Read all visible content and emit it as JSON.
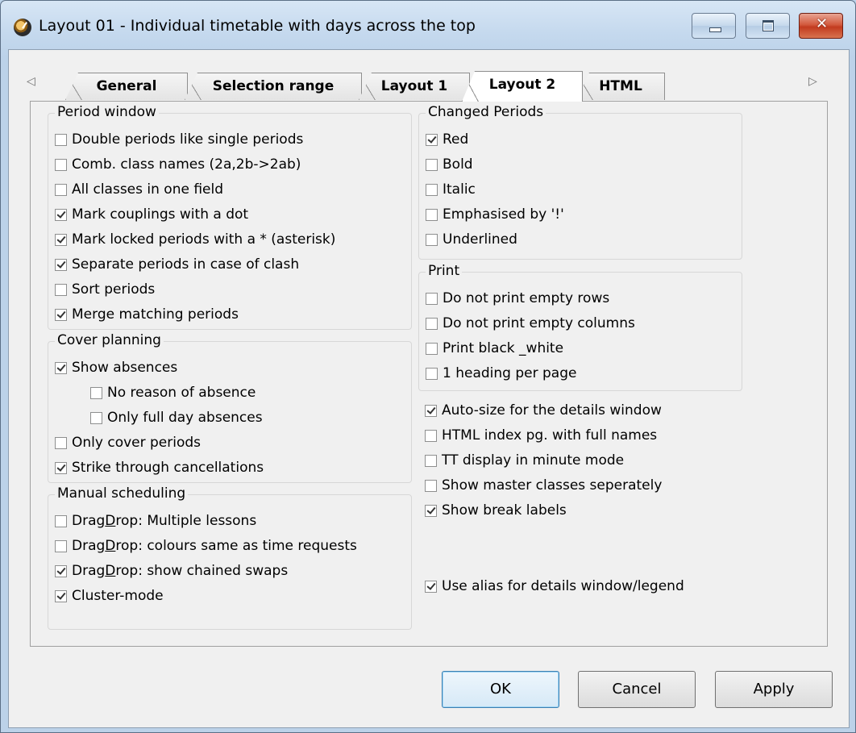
{
  "window": {
    "title": "Layout 01 - Individual timetable with days across the top",
    "controls": {
      "close_glyph": "✕"
    }
  },
  "tabs": [
    {
      "label": "General"
    },
    {
      "label": "Selection range"
    },
    {
      "label": "Layout 1"
    },
    {
      "label": "Layout 2"
    },
    {
      "label": "HTML"
    }
  ],
  "active_tab": "Layout 2",
  "tab_arrows": {
    "left": "◁",
    "right": "▷"
  },
  "groups": {
    "period_window": {
      "title": "Period window",
      "options": [
        {
          "label": "Double periods like single periods",
          "checked": false
        },
        {
          "label": "Comb. class names (2a,2b->2ab)",
          "checked": false
        },
        {
          "label": "All classes in one field",
          "checked": false
        },
        {
          "label": "Mark couplings with a dot",
          "checked": true
        },
        {
          "label": "Mark locked periods with a * (asterisk)",
          "checked": true
        },
        {
          "label": "Separate periods in case of clash",
          "checked": true
        },
        {
          "label": "Sort periods",
          "checked": false
        },
        {
          "label": "Merge matching periods",
          "checked": true
        }
      ]
    },
    "cover_planning": {
      "title": "Cover planning",
      "options": [
        {
          "label": "Show absences",
          "checked": true
        },
        {
          "label": "No reason of absence",
          "checked": false
        },
        {
          "label": "Only full day absences",
          "checked": false
        },
        {
          "label": "Only cover periods",
          "checked": false
        },
        {
          "label": "Strike through cancellations",
          "checked": true
        }
      ]
    },
    "manual_scheduling": {
      "title": "Manual scheduling",
      "options": [
        {
          "label_pre": "Drag",
          "label_u": "D",
          "label_post": "rop: Multiple lessons",
          "checked": false
        },
        {
          "label_pre": "Drag",
          "label_u": "D",
          "label_post": "rop: colours same as time requests",
          "checked": false
        },
        {
          "label_pre": "Drag",
          "label_u": "D",
          "label_post": "rop: show chained swaps",
          "checked": true
        },
        {
          "label_pre": "Cluster-mode",
          "label_u": "",
          "label_post": "",
          "checked": true
        }
      ]
    },
    "changed_periods": {
      "title": "Changed Periods",
      "options": [
        {
          "label": "Red",
          "checked": true
        },
        {
          "label": "Bold",
          "checked": false
        },
        {
          "label": "Italic",
          "checked": false
        },
        {
          "label": "Emphasised by '!'",
          "checked": false
        },
        {
          "label": "Underlined",
          "checked": false
        }
      ]
    },
    "print": {
      "title": "Print",
      "options": [
        {
          "label": "Do not print empty rows",
          "checked": false
        },
        {
          "label": "Do not print empty columns",
          "checked": false
        },
        {
          "label": "Print black _white",
          "checked": false
        },
        {
          "label": "1 heading per page",
          "checked": false
        }
      ]
    }
  },
  "misc_options": [
    {
      "label": "Auto-size for the details window",
      "checked": true
    },
    {
      "label": "HTML index pg. with full names",
      "checked": false
    },
    {
      "label": "TT display in minute mode",
      "checked": false
    },
    {
      "label": "Show master classes seperately",
      "checked": false
    },
    {
      "label": "Show break labels",
      "checked": true
    },
    {
      "label": "Use alias for details window/legend",
      "checked": true
    }
  ],
  "buttons": {
    "ok": "OK",
    "cancel": "Cancel",
    "apply": "Apply"
  }
}
